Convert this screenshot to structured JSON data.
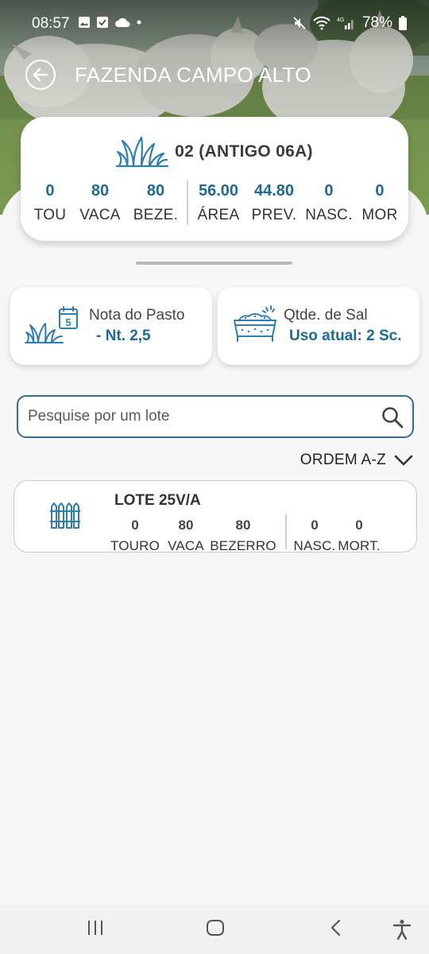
{
  "status_bar": {
    "time": "08:57",
    "battery": "78%"
  },
  "header": {
    "title": "FAZENDA CAMPO ALTO"
  },
  "pasture": {
    "name": "02 (ANTIGO 06A)",
    "stats": [
      {
        "value": "0",
        "label": "TOU"
      },
      {
        "value": "80",
        "label": "VACA"
      },
      {
        "value": "80",
        "label": "BEZE."
      },
      {
        "value": "56.00",
        "label": "ÁREA"
      },
      {
        "value": "44.80",
        "label": "PREV."
      },
      {
        "value": "0",
        "label": "NASC."
      },
      {
        "value": "0",
        "label": "MOR"
      }
    ]
  },
  "cards": {
    "grass": {
      "title": "Nota do Pasto",
      "value": "- Nt. 2,5",
      "calendar_day": "5"
    },
    "salt": {
      "title": "Qtde. de Sal",
      "value": "Uso atual: 2 Sc."
    }
  },
  "search": {
    "placeholder": "Pesquise por um lote",
    "value": ""
  },
  "sort": {
    "label": "ORDEM A-Z"
  },
  "lots": [
    {
      "name": "LOTE 25V/A",
      "stats": [
        {
          "value": "0",
          "label": "TOURO"
        },
        {
          "value": "80",
          "label": "VACA"
        },
        {
          "value": "80",
          "label": "BEZERRO"
        },
        {
          "value": "0",
          "label": "NASC."
        },
        {
          "value": "0",
          "label": "MORT."
        }
      ]
    }
  ],
  "colors": {
    "accent": "#1f6a93",
    "icon_blue": "#2e7fb0"
  }
}
